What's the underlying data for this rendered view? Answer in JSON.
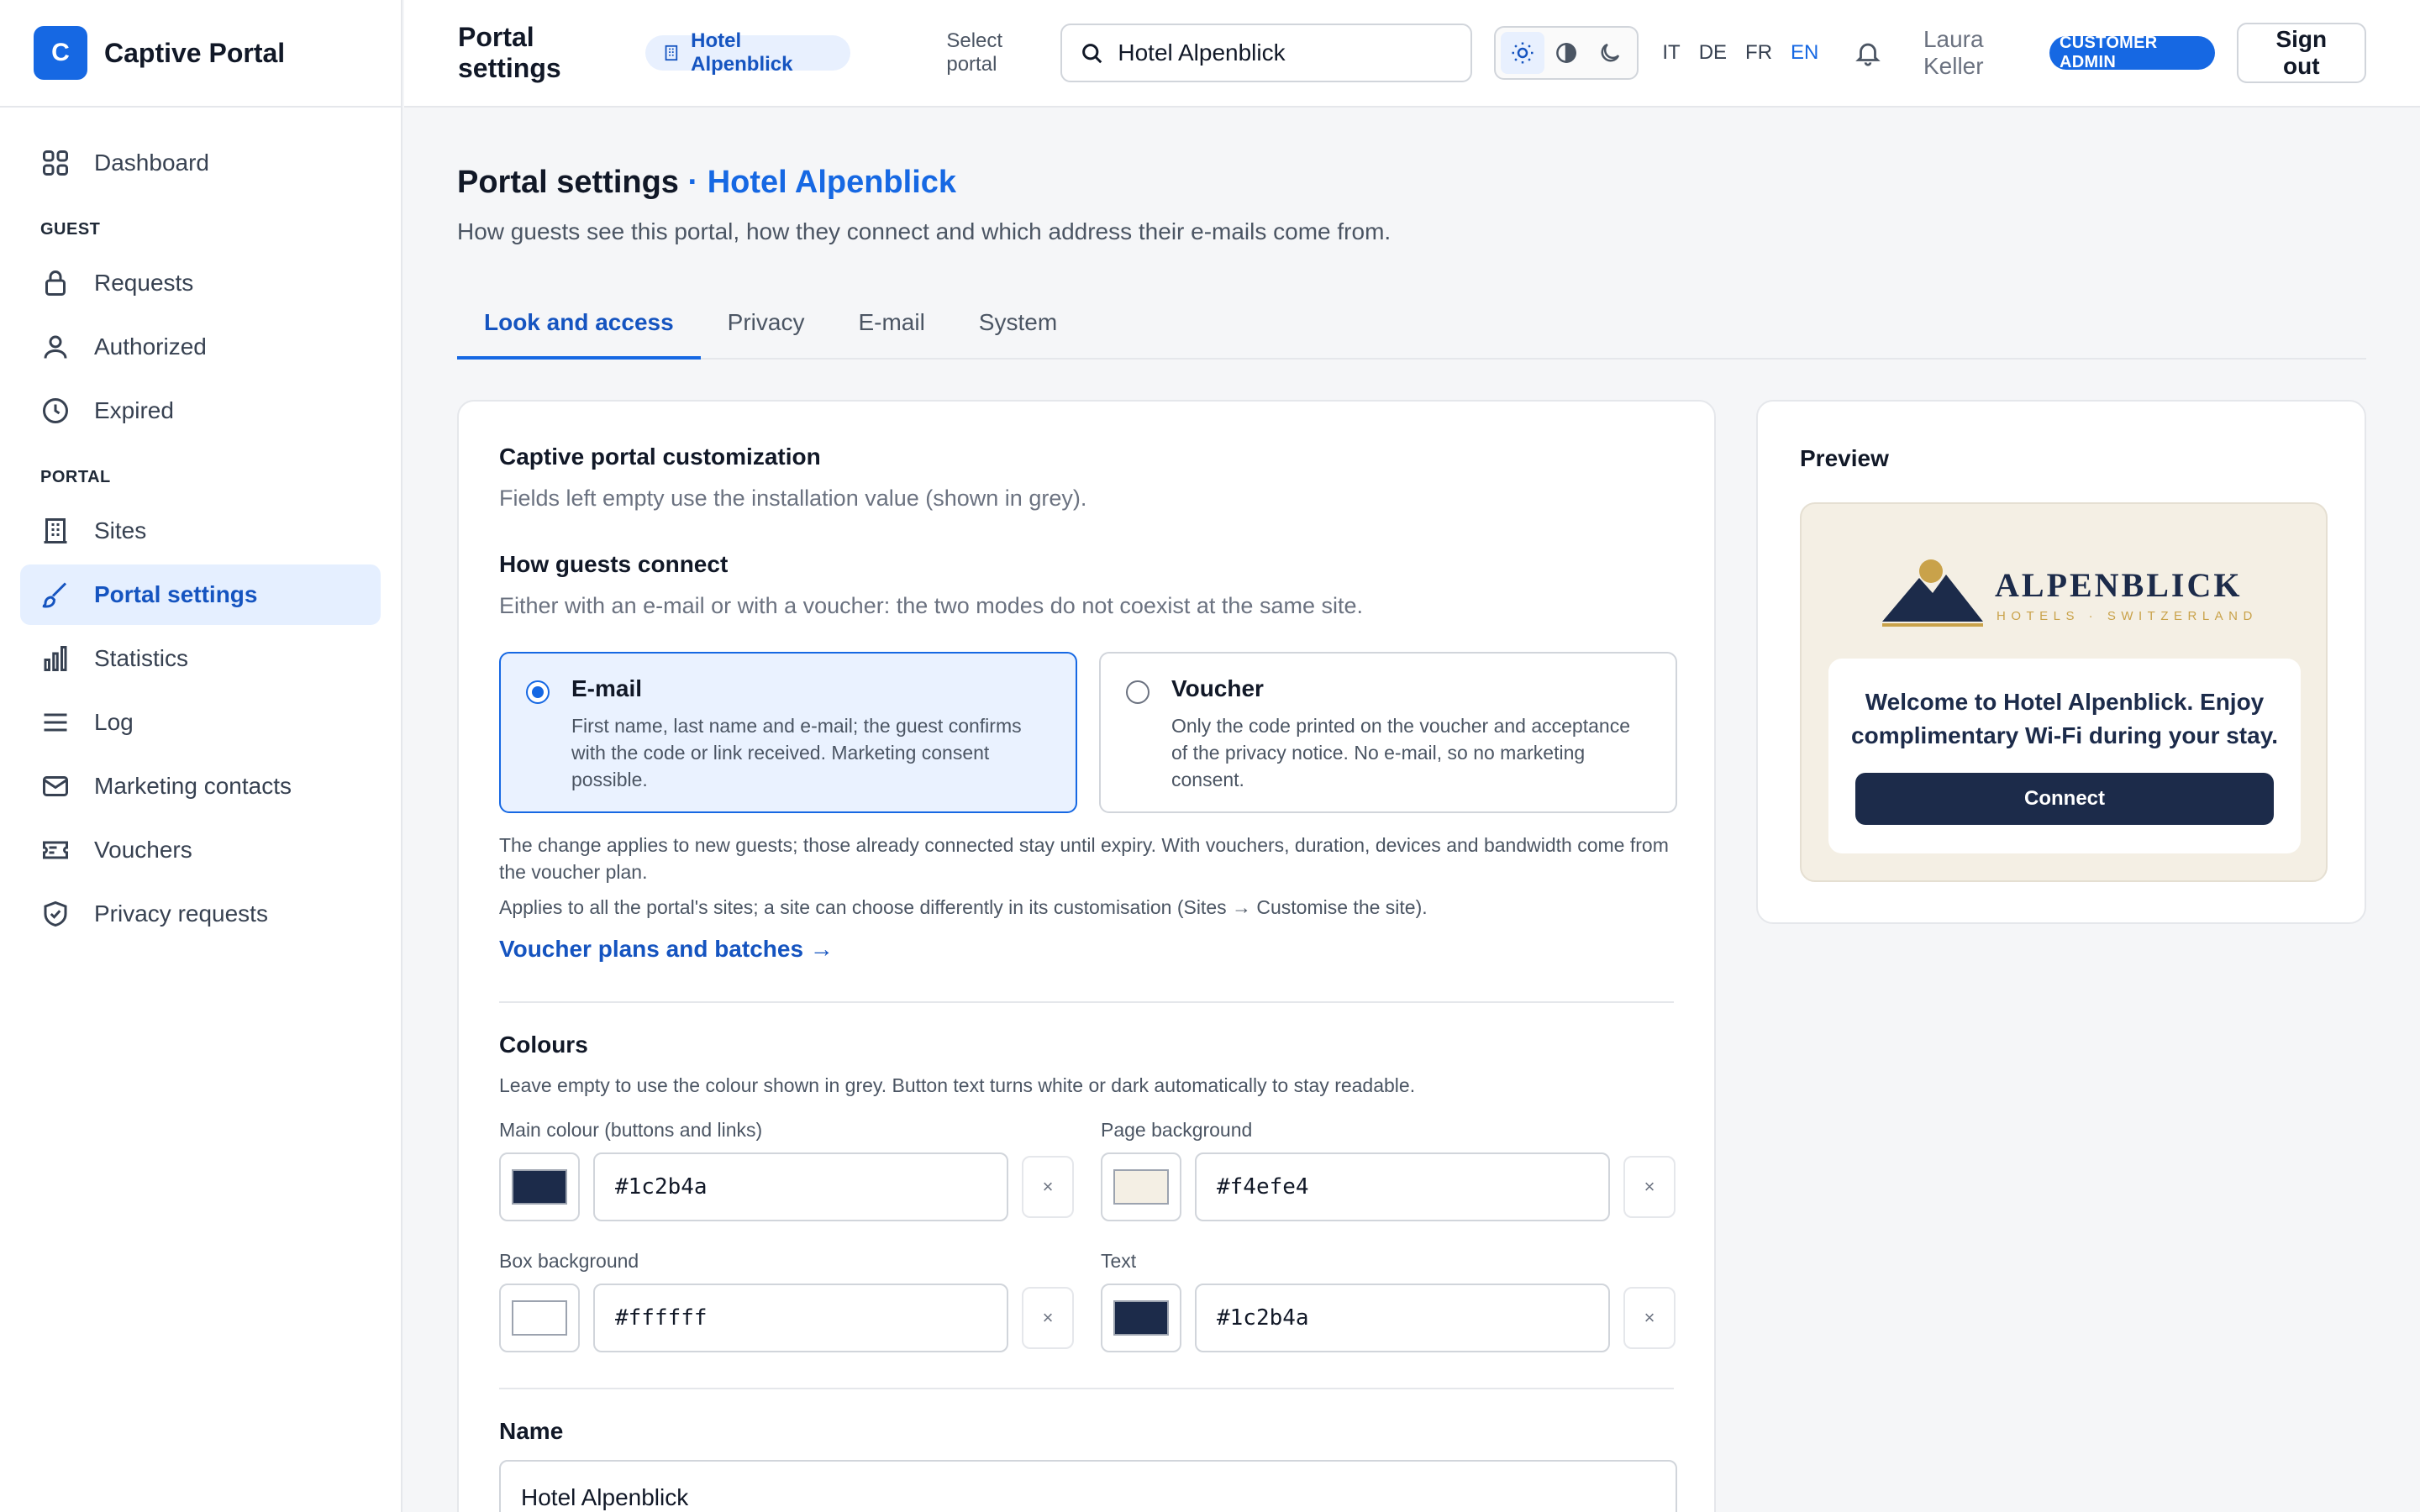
{
  "app": {
    "logo_letter": "C",
    "name": "Captive Portal"
  },
  "sidebar": {
    "dashboard": "Dashboard",
    "guest_section": "GUEST",
    "guest_items": [
      "Requests",
      "Authorized",
      "Expired"
    ],
    "portal_section": "PORTAL",
    "portal_items": [
      "Sites",
      "Portal settings",
      "Statistics",
      "Log",
      "Marketing contacts",
      "Vouchers",
      "Privacy requests"
    ]
  },
  "topbar": {
    "title": "Portal settings",
    "portal_chip": "Hotel Alpenblick",
    "select_label": "Select portal",
    "search_value": "Hotel Alpenblick",
    "languages": [
      "IT",
      "DE",
      "FR",
      "EN"
    ],
    "active_language": "EN",
    "user_name": "Laura Keller",
    "role_badge": "CUSTOMER ADMIN",
    "sign_out": "Sign out"
  },
  "page": {
    "title": "Portal settings",
    "title_accent": "· Hotel Alpenblick",
    "subtitle": "How guests see this portal, how they connect and which address their e-mails come from.",
    "tabs": [
      "Look and access",
      "Privacy",
      "E-mail",
      "System"
    ],
    "active_tab": "Look and access"
  },
  "customization": {
    "heading": "Captive portal customization",
    "hint": "Fields left empty use the installation value (shown in grey).",
    "connect_heading": "How guests connect",
    "connect_hint": "Either with an e-mail or with a voucher: the two modes do not coexist at the same site.",
    "mode_email": {
      "title": "E-mail",
      "desc": "First name, last name and e-mail; the guest confirms with the code or link received. Marketing consent possible.",
      "selected": true
    },
    "mode_voucher": {
      "title": "Voucher",
      "desc": "Only the code printed on the voucher and acceptance of the privacy notice. No e-mail, so no marketing consent.",
      "selected": false
    },
    "note_1": "The change applies to new guests; those already connected stay until expiry. With vouchers, duration, devices and bandwidth come from the voucher plan.",
    "note_2": "Applies to all the portal's sites; a site can choose differently in its customisation (Sites → Customise the site).",
    "voucher_link": "Voucher plans and batches →"
  },
  "colours": {
    "heading": "Colours",
    "hint": "Leave empty to use the colour shown in grey. Button text turns white or dark automatically to stay readable.",
    "main_label": "Main colour (buttons and links)",
    "main_value": "#1c2b4a",
    "page_bg_label": "Page background",
    "page_bg_value": "#f4efe4",
    "box_bg_label": "Box background",
    "box_bg_value": "#ffffff",
    "text_label": "Text",
    "text_value": "#1c2b4a",
    "clear_symbol": "×"
  },
  "name_field": {
    "label": "Name",
    "value": "Hotel Alpenblick"
  },
  "preview": {
    "title": "Preview",
    "logo_name": "ALPENBLICK",
    "logo_tagline": "HOTELS · SWITZERLAND",
    "welcome": "Welcome to Hotel Alpenblick. Enjoy complimentary Wi-Fi during your stay.",
    "connect_button": "Connect"
  }
}
